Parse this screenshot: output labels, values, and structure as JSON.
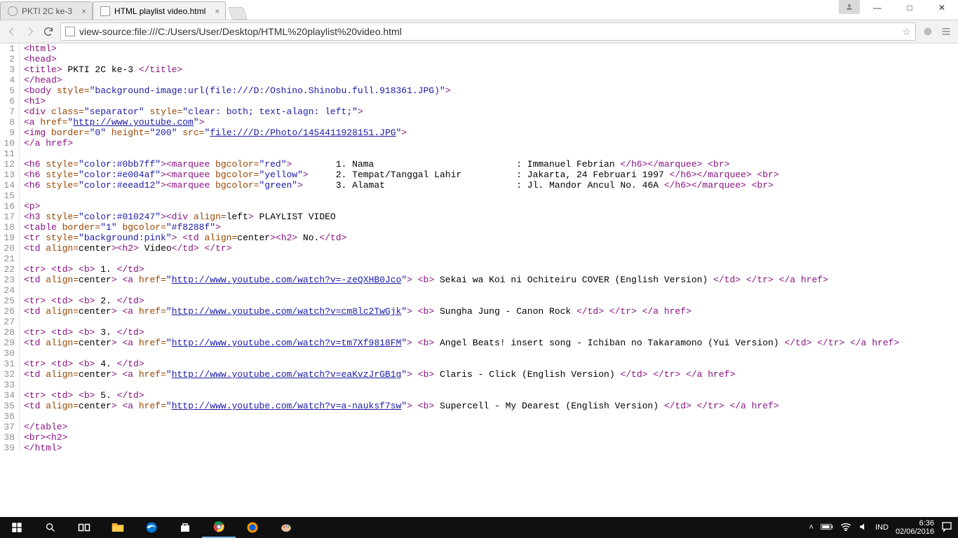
{
  "window": {
    "tabs": [
      {
        "title": "PKTI 2C ke-3",
        "active": false
      },
      {
        "title": "HTML playlist video.html",
        "active": true
      }
    ],
    "controls": {
      "min": "—",
      "max": "□",
      "close": "✕"
    }
  },
  "toolbar": {
    "url": "view-source:file:///C:/Users/User/Desktop/HTML%20playlist%20video.html"
  },
  "source": {
    "lines": [
      {
        "n": 1,
        "seg": [
          [
            "tag",
            "<html>"
          ]
        ]
      },
      {
        "n": 2,
        "seg": [
          [
            "tag",
            "<head>"
          ]
        ]
      },
      {
        "n": 3,
        "seg": [
          [
            "tag",
            "<title>"
          ],
          [
            "text",
            " PKTI 2C ke-3 "
          ],
          [
            "tag",
            "</title>"
          ]
        ]
      },
      {
        "n": 4,
        "seg": [
          [
            "tag",
            "</head>"
          ]
        ]
      },
      {
        "n": 5,
        "seg": [
          [
            "tag",
            "<body "
          ],
          [
            "attr",
            "style="
          ],
          [
            "val",
            "\"background-image:url(file:///D:/Oshino.Shinobu.full.918361.JPG)\""
          ],
          [
            "tag",
            ">"
          ]
        ]
      },
      {
        "n": 6,
        "seg": [
          [
            "tag",
            "<h1>"
          ]
        ]
      },
      {
        "n": 7,
        "seg": [
          [
            "tag",
            "<div "
          ],
          [
            "attr",
            "class="
          ],
          [
            "val",
            "\"separator\""
          ],
          [
            "tag",
            " "
          ],
          [
            "attr",
            "style="
          ],
          [
            "val",
            "\"clear: both; text-alagn: left;\""
          ],
          [
            "tag",
            ">"
          ]
        ]
      },
      {
        "n": 8,
        "seg": [
          [
            "tag",
            "<a "
          ],
          [
            "attr",
            "href="
          ],
          [
            "val",
            "\""
          ],
          [
            "link",
            "http://www.youtube.com"
          ],
          [
            "val",
            "\""
          ],
          [
            "tag",
            ">"
          ]
        ]
      },
      {
        "n": 9,
        "seg": [
          [
            "tag",
            "<img "
          ],
          [
            "attr",
            "border="
          ],
          [
            "val",
            "\"0\""
          ],
          [
            "tag",
            " "
          ],
          [
            "attr",
            "height="
          ],
          [
            "val",
            "\"200\""
          ],
          [
            "tag",
            " "
          ],
          [
            "attr",
            "src="
          ],
          [
            "val",
            "\""
          ],
          [
            "link",
            "file:///D:/Photo/1454411928151.JPG"
          ],
          [
            "val",
            "\""
          ],
          [
            "tag",
            ">"
          ]
        ]
      },
      {
        "n": 10,
        "seg": [
          [
            "tag",
            "</a href>"
          ]
        ]
      },
      {
        "n": 11,
        "seg": [
          [
            "text",
            ""
          ]
        ]
      },
      {
        "n": 12,
        "seg": [
          [
            "tag",
            "<h6 "
          ],
          [
            "attr",
            "style="
          ],
          [
            "val",
            "\"color:#0bb7ff\""
          ],
          [
            "tag",
            "><marquee "
          ],
          [
            "attr",
            "bgcolor="
          ],
          [
            "val",
            "\"red\""
          ],
          [
            "tag",
            ">"
          ],
          [
            "text",
            "        1. Nama                          : Immanuel Febrian "
          ],
          [
            "tag",
            "</h6></marquee> <br>"
          ]
        ]
      },
      {
        "n": 13,
        "seg": [
          [
            "tag",
            "<h6 "
          ],
          [
            "attr",
            "style="
          ],
          [
            "val",
            "\"color:#e004af\""
          ],
          [
            "tag",
            "><marquee "
          ],
          [
            "attr",
            "bgcolor="
          ],
          [
            "val",
            "\"yellow\""
          ],
          [
            "tag",
            ">"
          ],
          [
            "text",
            "     2. Tempat/Tanggal Lahir          : Jakarta, 24 Februari 1997 "
          ],
          [
            "tag",
            "</h6></marquee> <br>"
          ]
        ]
      },
      {
        "n": 14,
        "seg": [
          [
            "tag",
            "<h6 "
          ],
          [
            "attr",
            "style="
          ],
          [
            "val",
            "\"color:#eead12\""
          ],
          [
            "tag",
            "><marquee "
          ],
          [
            "attr",
            "bgcolor="
          ],
          [
            "val",
            "\"green\""
          ],
          [
            "tag",
            ">"
          ],
          [
            "text",
            "      3. Alamat                        : Jl. Mandor Ancul No. 46A "
          ],
          [
            "tag",
            "</h6></marquee> <br>"
          ]
        ]
      },
      {
        "n": 15,
        "seg": [
          [
            "text",
            ""
          ]
        ]
      },
      {
        "n": 16,
        "seg": [
          [
            "tag",
            "<p>"
          ]
        ]
      },
      {
        "n": 17,
        "seg": [
          [
            "tag",
            "<h3 "
          ],
          [
            "attr",
            "style="
          ],
          [
            "val",
            "\"color:#010247\""
          ],
          [
            "tag",
            "><div "
          ],
          [
            "attr",
            "align="
          ],
          [
            "text",
            "left"
          ],
          [
            "tag",
            ">"
          ],
          [
            "text",
            " PLAYLIST VIDEO"
          ]
        ]
      },
      {
        "n": 18,
        "seg": [
          [
            "tag",
            "<table "
          ],
          [
            "attr",
            "border="
          ],
          [
            "val",
            "\"1\""
          ],
          [
            "tag",
            " "
          ],
          [
            "attr",
            "bgcolor="
          ],
          [
            "val",
            "\"#f8288f\""
          ],
          [
            "tag",
            ">"
          ]
        ]
      },
      {
        "n": 19,
        "seg": [
          [
            "tag",
            "<tr "
          ],
          [
            "attr",
            "style="
          ],
          [
            "val",
            "\"background:pink\""
          ],
          [
            "tag",
            "> <td "
          ],
          [
            "attr",
            "align="
          ],
          [
            "text",
            "center"
          ],
          [
            "tag",
            "><h2>"
          ],
          [
            "text",
            " No."
          ],
          [
            "tag",
            "</td>"
          ]
        ]
      },
      {
        "n": 20,
        "seg": [
          [
            "tag",
            "<td "
          ],
          [
            "attr",
            "align="
          ],
          [
            "text",
            "center"
          ],
          [
            "tag",
            "><h2>"
          ],
          [
            "text",
            " Video"
          ],
          [
            "tag",
            "</td> </tr>"
          ]
        ]
      },
      {
        "n": 21,
        "seg": [
          [
            "text",
            ""
          ]
        ]
      },
      {
        "n": 22,
        "seg": [
          [
            "tag",
            "<tr> <td> <b>"
          ],
          [
            "text",
            " 1. "
          ],
          [
            "tag",
            "</td>"
          ]
        ]
      },
      {
        "n": 23,
        "seg": [
          [
            "tag",
            "<td "
          ],
          [
            "attr",
            "align="
          ],
          [
            "text",
            "center"
          ],
          [
            "tag",
            "> <a "
          ],
          [
            "attr",
            "href="
          ],
          [
            "val",
            "\""
          ],
          [
            "link",
            "http://www.youtube.com/watch?v=-zeQXHB0Jco"
          ],
          [
            "val",
            "\""
          ],
          [
            "tag",
            "> <b>"
          ],
          [
            "text",
            " Sekai wa Koi ni Ochiteiru COVER (English Version) "
          ],
          [
            "tag",
            "</td> </tr> </a href>"
          ]
        ]
      },
      {
        "n": 24,
        "seg": [
          [
            "text",
            ""
          ]
        ]
      },
      {
        "n": 25,
        "seg": [
          [
            "tag",
            "<tr> <td> <b>"
          ],
          [
            "text",
            " 2. "
          ],
          [
            "tag",
            "</td>"
          ]
        ]
      },
      {
        "n": 26,
        "seg": [
          [
            "tag",
            "<td "
          ],
          [
            "attr",
            "align="
          ],
          [
            "text",
            "center"
          ],
          [
            "tag",
            "> <a "
          ],
          [
            "attr",
            "href="
          ],
          [
            "val",
            "\""
          ],
          [
            "link",
            "http://www.youtube.com/watch?v=cm8lc2TwGjk"
          ],
          [
            "val",
            "\""
          ],
          [
            "tag",
            "> <b>"
          ],
          [
            "text",
            " Sungha Jung - Canon Rock "
          ],
          [
            "tag",
            "</td> </tr> </a href>"
          ]
        ]
      },
      {
        "n": 27,
        "seg": [
          [
            "text",
            ""
          ]
        ]
      },
      {
        "n": 28,
        "seg": [
          [
            "tag",
            "<tr> <td> <b>"
          ],
          [
            "text",
            " 3. "
          ],
          [
            "tag",
            "</td>"
          ]
        ]
      },
      {
        "n": 29,
        "seg": [
          [
            "tag",
            "<td "
          ],
          [
            "attr",
            "align="
          ],
          [
            "text",
            "center"
          ],
          [
            "tag",
            "> <a "
          ],
          [
            "attr",
            "href="
          ],
          [
            "val",
            "\""
          ],
          [
            "link",
            "http://www.youtube.com/watch?v=tm7Xf9818FM"
          ],
          [
            "val",
            "\""
          ],
          [
            "tag",
            "> <b>"
          ],
          [
            "text",
            " Angel Beats! insert song - Ichiban no Takaramono (Yui Version) "
          ],
          [
            "tag",
            "</td> </tr> </a href>"
          ]
        ]
      },
      {
        "n": 30,
        "seg": [
          [
            "text",
            ""
          ]
        ]
      },
      {
        "n": 31,
        "seg": [
          [
            "tag",
            "<tr> <td> <b>"
          ],
          [
            "text",
            " 4. "
          ],
          [
            "tag",
            "</td>"
          ]
        ]
      },
      {
        "n": 32,
        "seg": [
          [
            "tag",
            "<td "
          ],
          [
            "attr",
            "align="
          ],
          [
            "text",
            "center"
          ],
          [
            "tag",
            "> <a "
          ],
          [
            "attr",
            "href="
          ],
          [
            "val",
            "\""
          ],
          [
            "link",
            "http://www.youtube.com/watch?v=eaKvzJrGB1g"
          ],
          [
            "val",
            "\""
          ],
          [
            "tag",
            "> <b>"
          ],
          [
            "text",
            " Claris - Click (English Version) "
          ],
          [
            "tag",
            "</td> </tr> </a href>"
          ]
        ]
      },
      {
        "n": 33,
        "seg": [
          [
            "text",
            ""
          ]
        ]
      },
      {
        "n": 34,
        "seg": [
          [
            "tag",
            "<tr> <td> <b>"
          ],
          [
            "text",
            " 5. "
          ],
          [
            "tag",
            "</td>"
          ]
        ]
      },
      {
        "n": 35,
        "seg": [
          [
            "tag",
            "<td "
          ],
          [
            "attr",
            "align="
          ],
          [
            "text",
            "center"
          ],
          [
            "tag",
            "> <a "
          ],
          [
            "attr",
            "href="
          ],
          [
            "val",
            "\""
          ],
          [
            "link",
            "http://www.youtube.com/watch?v=a-nauksf7sw"
          ],
          [
            "val",
            "\""
          ],
          [
            "tag",
            "> <b>"
          ],
          [
            "text",
            " Supercell - My Dearest (English Version) "
          ],
          [
            "tag",
            "</td> </tr> </a href>"
          ]
        ]
      },
      {
        "n": 36,
        "seg": [
          [
            "text",
            ""
          ]
        ]
      },
      {
        "n": 37,
        "seg": [
          [
            "tag",
            "</table>"
          ]
        ]
      },
      {
        "n": 38,
        "seg": [
          [
            "tag",
            "<br><h2>"
          ]
        ]
      },
      {
        "n": 39,
        "seg": [
          [
            "tag",
            "</html>"
          ]
        ]
      }
    ]
  },
  "taskbar": {
    "lang": "IND",
    "time": "6:36",
    "date": "02/06/2016",
    "tray_up": "˄",
    "wifi": "▂▄▆",
    "battery": "▮",
    "notif": "▭"
  }
}
